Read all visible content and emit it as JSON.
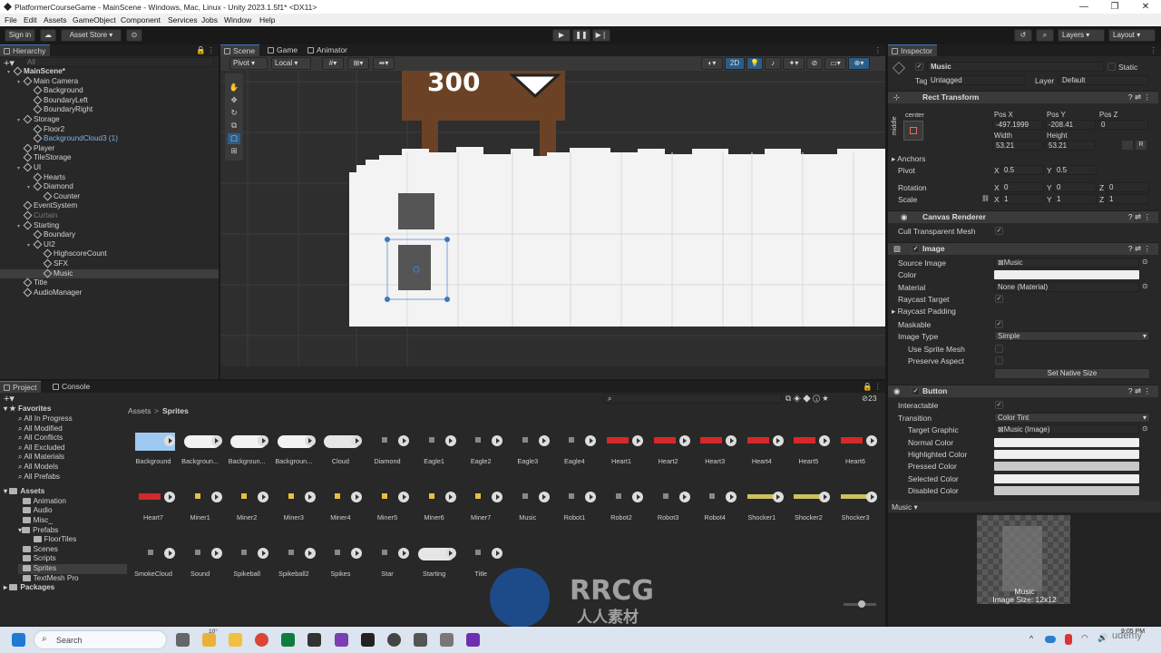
{
  "window": {
    "title": "PlatformerCourseGame - MainScene - Windows, Mac, Linux - Unity 2023.1.5f1* <DX11>",
    "controls": [
      "—",
      "❐",
      "✕"
    ]
  },
  "menu": [
    "File",
    "Edit",
    "Assets",
    "GameObject",
    "Component",
    "Services",
    "Jobs",
    "Window",
    "Help"
  ],
  "toolbar": {
    "sign_in": "Sign in",
    "asset_store": "Asset Store ▾",
    "layers": "Layers",
    "layout": "Layout"
  },
  "hierarchy": {
    "tab": "Hierarchy",
    "search_placeholder": "All",
    "items": [
      {
        "label": "MainScene*",
        "depth": 0
      },
      {
        "label": "Main Camera",
        "depth": 1
      },
      {
        "label": "Background",
        "depth": 2
      },
      {
        "label": "BoundaryLeft",
        "depth": 2
      },
      {
        "label": "BoundaryRight",
        "depth": 2
      },
      {
        "label": "Storage",
        "depth": 1
      },
      {
        "label": "Floor2",
        "depth": 2
      },
      {
        "label": "BackgroundCloud3 (1)",
        "depth": 2
      },
      {
        "label": "Player",
        "depth": 1
      },
      {
        "label": "TileStorage",
        "depth": 1
      },
      {
        "label": "UI",
        "depth": 1
      },
      {
        "label": "Hearts",
        "depth": 2
      },
      {
        "label": "Diamond",
        "depth": 2
      },
      {
        "label": "Counter",
        "depth": 3
      },
      {
        "label": "EventSystem",
        "depth": 1
      },
      {
        "label": "Curtain",
        "depth": 1
      },
      {
        "label": "Starting",
        "depth": 1
      },
      {
        "label": "Boundary",
        "depth": 2
      },
      {
        "label": "UI2",
        "depth": 2
      },
      {
        "label": "HighscoreCount",
        "depth": 3
      },
      {
        "label": "SFX",
        "depth": 3
      },
      {
        "label": "Music",
        "depth": 3
      },
      {
        "label": "Title",
        "depth": 1
      },
      {
        "label": "AudioManager",
        "depth": 1
      }
    ]
  },
  "scene": {
    "tabs": [
      "Scene",
      "Game",
      "Animator"
    ],
    "pivot": "Pivot",
    "local": "Local",
    "mode2d": "2D",
    "score_text": "300"
  },
  "inspector": {
    "tab": "Inspector",
    "object_name": "Music",
    "static_label": "Static",
    "tag_label": "Tag",
    "tag_value": "Untagged",
    "layer_label": "Layer",
    "layer_value": "Default",
    "rect_transform": {
      "title": "Rect Transform",
      "anchor_h": "center",
      "anchor_v": "middle",
      "pos_x_label": "Pos X",
      "pos_x": "-497.1999",
      "pos_y_label": "Pos Y",
      "pos_y": "-208.41",
      "pos_z_label": "Pos Z",
      "pos_z": "0",
      "width_label": "Width",
      "width": "53.21",
      "height_label": "Height",
      "height": "53.21",
      "anchors": "Anchors",
      "pivot": "Pivot",
      "pivot_x": "0.5",
      "pivot_y": "0.5",
      "rotation": "Rotation",
      "rot_x": "0",
      "rot_y": "0",
      "rot_z": "0",
      "scale": "Scale",
      "scale_x": "1",
      "scale_y": "1",
      "scale_z": "1",
      "x": "X",
      "y": "Y",
      "z": "Z"
    },
    "canvas_renderer": {
      "title": "Canvas Renderer",
      "cull": "Cull Transparent Mesh"
    },
    "image": {
      "title": "Image",
      "source_image_label": "Source Image",
      "source_image": "Music",
      "color_label": "Color",
      "material_label": "Material",
      "material": "None (Material)",
      "raycast_target": "Raycast Target",
      "raycast_padding": "Raycast Padding",
      "maskable": "Maskable",
      "image_type_label": "Image Type",
      "image_type": "Simple",
      "use_sprite_mesh": "Use Sprite Mesh",
      "preserve_aspect": "Preserve Aspect",
      "set_native_size": "Set Native Size"
    },
    "button": {
      "title": "Button",
      "interactable": "Interactable",
      "transition_label": "Transition",
      "transition": "Color Tint",
      "target_graphic_label": "Target Graphic",
      "target_graphic": "Music (Image)",
      "normal_color": "Normal Color",
      "highlighted_color": "Highlighted Color",
      "pressed_color": "Pressed Color",
      "selected_color": "Selected Color",
      "disabled_color": "Disabled Color"
    },
    "preview": {
      "header": "Music ▾",
      "name": "Music",
      "size": "Image Size: 12x12"
    }
  },
  "project": {
    "tabs": [
      "Project",
      "Console"
    ],
    "hidden_count": "23",
    "breadcrumb": [
      "Assets",
      "Sprites"
    ],
    "favorites_label": "Favorites",
    "favorites": [
      "All In Progress",
      "All Modified",
      "All Conflicts",
      "All Excluded",
      "All Materials",
      "All Models",
      "All Prefabs"
    ],
    "assets_label": "Assets",
    "folders": [
      {
        "label": "Animation",
        "depth": 1
      },
      {
        "label": "Audio",
        "depth": 1
      },
      {
        "label": "Misc_",
        "depth": 1
      },
      {
        "label": "Prefabs",
        "depth": 1
      },
      {
        "label": "FloorTiles",
        "depth": 2
      },
      {
        "label": "Scenes",
        "depth": 1
      },
      {
        "label": "Scripts",
        "depth": 1
      },
      {
        "label": "Sprites",
        "depth": 1
      },
      {
        "label": "TextMesh Pro",
        "depth": 1
      }
    ],
    "packages_label": "Packages",
    "sprites": [
      [
        "Background",
        "Backgroun...",
        "Backgroun...",
        "Backgroun...",
        "Cloud",
        "Diamond",
        "Eagle1",
        "Eagle2",
        "Eagle3",
        "Eagle4",
        "Heart1",
        "Heart2",
        "Heart3",
        "Heart4",
        "Heart5",
        "Heart6"
      ],
      [
        "Heart7",
        "Miner1",
        "Miner2",
        "Miner3",
        "Miner4",
        "Miner5",
        "Miner6",
        "Miner7",
        "Music",
        "Robot1",
        "Robot2",
        "Robot3",
        "Robot4",
        "Shocker1",
        "Shocker2",
        "Shocker3"
      ],
      [
        "SmokeCloud",
        "Sound",
        "Spikeball",
        "Spikeball2",
        "Spikes",
        "Star",
        "Starting",
        "Title"
      ]
    ]
  },
  "watermark": {
    "brand": "RRCG",
    "sub": "人人素材"
  },
  "taskbar": {
    "search_placeholder": "Search",
    "weather": "10°",
    "time": "9:05 PM",
    "site": "udemy"
  },
  "colors": {
    "accent": "#3a79bb",
    "panel": "#282828",
    "scene_bg": "#2e2e2e",
    "sky_game": "#ffffff",
    "wood": "#6b4226"
  }
}
